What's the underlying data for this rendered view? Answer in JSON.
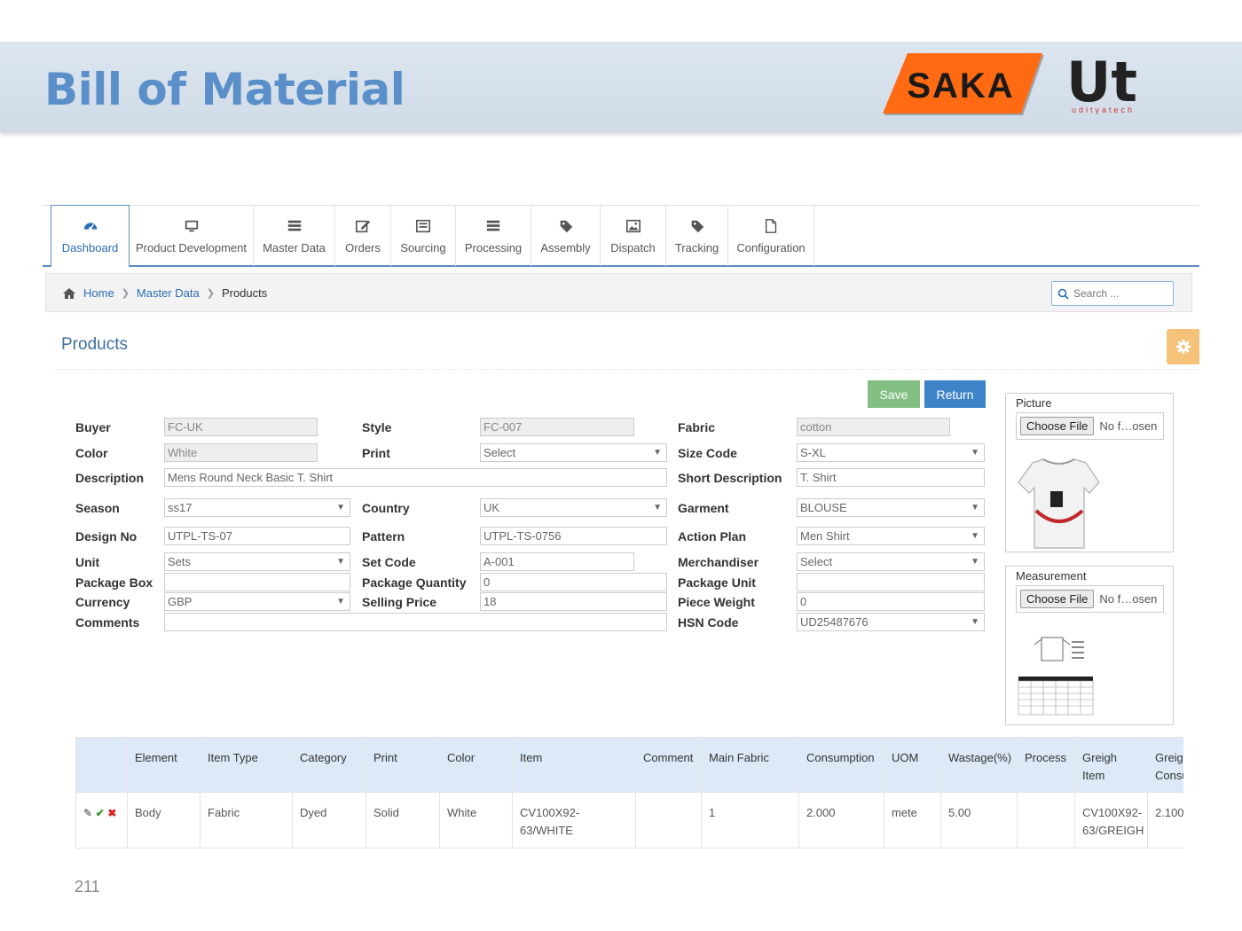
{
  "slide": {
    "title": "Bill of Material",
    "page_number": "211"
  },
  "logos": {
    "saka": "SAKA",
    "ut": "Ut",
    "ut_sub": "udityatech"
  },
  "nav": {
    "tabs": [
      {
        "label": "Dashboard",
        "icon": "dashboard-icon"
      },
      {
        "label": "Product Development",
        "icon": "monitor-icon"
      },
      {
        "label": "Master Data",
        "icon": "list-icon"
      },
      {
        "label": "Orders",
        "icon": "edit-icon"
      },
      {
        "label": "Sourcing",
        "icon": "list-alt-icon"
      },
      {
        "label": "Processing",
        "icon": "list-icon"
      },
      {
        "label": "Assembly",
        "icon": "tag-icon"
      },
      {
        "label": "Dispatch",
        "icon": "picture-icon"
      },
      {
        "label": "Tracking",
        "icon": "tag-icon"
      },
      {
        "label": "Configuration",
        "icon": "file-icon"
      }
    ]
  },
  "breadcrumb": {
    "home": "Home",
    "master_data": "Master Data",
    "current": "Products"
  },
  "search": {
    "placeholder": "Search ..."
  },
  "page": {
    "heading": "Products"
  },
  "buttons": {
    "save": "Save",
    "return": "Return"
  },
  "form": {
    "buyer": {
      "label": "Buyer",
      "value": "FC-UK"
    },
    "style": {
      "label": "Style",
      "value": "FC-007"
    },
    "fabric": {
      "label": "Fabric",
      "value": "cotton"
    },
    "color": {
      "label": "Color",
      "value": "White"
    },
    "print": {
      "label": "Print",
      "value": "Select"
    },
    "size_code": {
      "label": "Size Code",
      "value": "S-XL"
    },
    "description": {
      "label": "Description",
      "value": "Mens Round Neck Basic T. Shirt"
    },
    "short_description": {
      "label": "Short Description",
      "value": "T. Shirt"
    },
    "season": {
      "label": "Season",
      "value": "ss17"
    },
    "country": {
      "label": "Country",
      "value": "UK"
    },
    "garment": {
      "label": "Garment",
      "value": "BLOUSE"
    },
    "design_no": {
      "label": "Design No",
      "value": "UTPL-TS-07"
    },
    "pattern": {
      "label": "Pattern",
      "value": "UTPL-TS-0756"
    },
    "action_plan": {
      "label": "Action Plan",
      "value": "Men Shirt"
    },
    "unit": {
      "label": "Unit",
      "value": "Sets"
    },
    "set_code": {
      "label": "Set Code",
      "value": "A-001"
    },
    "merchandiser": {
      "label": "Merchandiser",
      "value": "Select"
    },
    "package_box": {
      "label": "Package Box",
      "value": ""
    },
    "package_quantity": {
      "label": "Package Quantity",
      "value": "0"
    },
    "package_unit": {
      "label": "Package Unit",
      "value": ""
    },
    "currency": {
      "label": "Currency",
      "value": "GBP"
    },
    "selling_price": {
      "label": "Selling Price",
      "value": "18"
    },
    "piece_weight": {
      "label": "Piece Weight",
      "value": "0"
    },
    "comments": {
      "label": "Comments",
      "value": ""
    },
    "hsn_code": {
      "label": "HSN Code",
      "value": "UD25487676"
    }
  },
  "picture_panel": {
    "title": "Picture",
    "choose": "Choose File",
    "file": "No f…osen"
  },
  "measurement_panel": {
    "title": "Measurement",
    "choose": "Choose File",
    "file": "No f…osen"
  },
  "table": {
    "headers": [
      "",
      "Element",
      "Item Type",
      "Category",
      "Print",
      "Color",
      "Item",
      "Comment",
      "Main Fabric",
      "Consumption",
      "UOM",
      "Wastage(%)",
      "Process",
      "Greigh Item",
      "Greigh Consu"
    ],
    "rows": [
      [
        "",
        "Body",
        "Fabric",
        "Dyed",
        "Solid",
        "White",
        "CV100X92-63/WHITE",
        "",
        "1",
        "2.000",
        "mete",
        "5.00",
        "",
        "CV100X92-63/GREIGH",
        "2.100"
      ]
    ]
  },
  "colors": {
    "accent": "#2a6db5",
    "save": "#83bf82",
    "return": "#3d83c7",
    "title": "#5b8fc9",
    "saka": "#ff6a13"
  }
}
